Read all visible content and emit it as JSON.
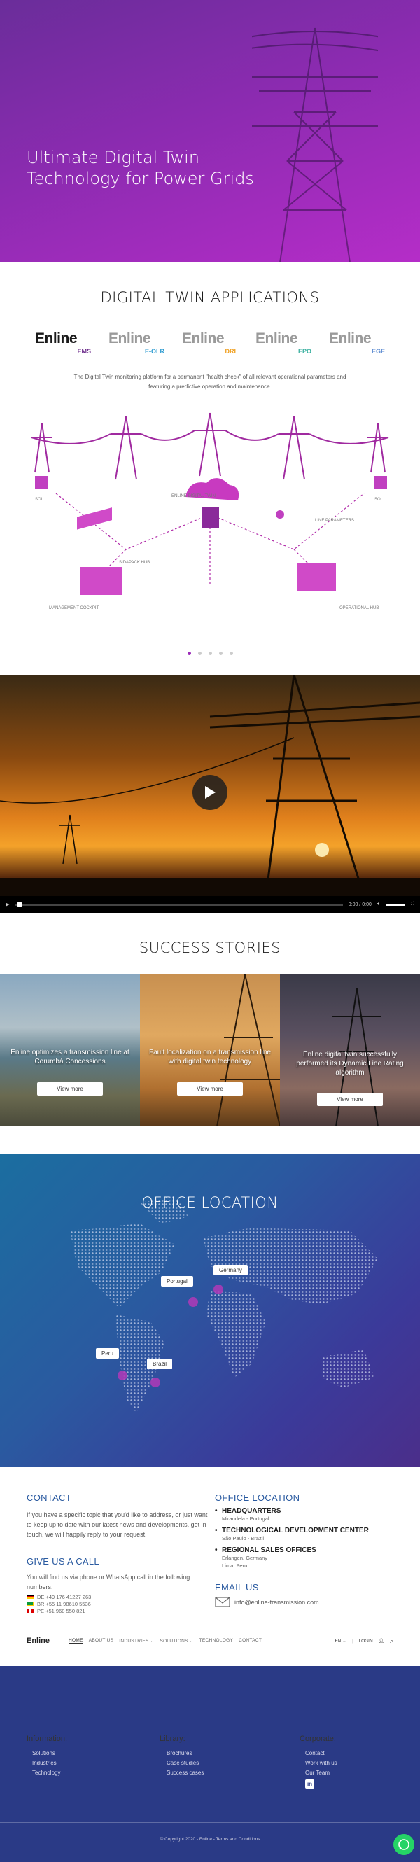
{
  "hero": {
    "title": "Ultimate Digital Twin Technology for Power Grids"
  },
  "digital_twin": {
    "title": "DIGITAL TWIN APPLICATIONS",
    "logos": [
      {
        "wordmark": "Enline",
        "code": "EMS",
        "color": "#1a1a1a",
        "code_color": "#6b2a8a"
      },
      {
        "wordmark": "Enline",
        "code": "E-OLR",
        "color": "#9a9a9a",
        "code_color": "#2a9ad0"
      },
      {
        "wordmark": "Enline",
        "code": "DRL",
        "color": "#9a9a9a",
        "code_color": "#f0a020"
      },
      {
        "wordmark": "Enline",
        "code": "EPO",
        "color": "#9a9a9a",
        "code_color": "#3ab0a0"
      },
      {
        "wordmark": "Enline",
        "code": "EGE",
        "color": "#9a9a9a",
        "code_color": "#5a8ad0"
      }
    ],
    "description": "The Digital Twin monitoring platform for a permanent \"health check\" of all relevant operational parameters and featuring a predictive operation and maintenance.",
    "illus_labels": {
      "sensors_left": "SOI",
      "sensors_right": "SOI",
      "digital_twin": "ENLINE DIGITAL TWIN",
      "sidapack": "SIDAPACK HUB",
      "line_parameters": "LINE PARAMETERS",
      "management": "MANAGEMENT COCKPIT",
      "operational": "OPERATIONAL HUB"
    },
    "slides": 5,
    "active_slide": 0
  },
  "video": {
    "time": "0:00 / 0:00"
  },
  "success": {
    "title": "SUCCESS STORIES",
    "stories": [
      {
        "caption": "Enline optimizes a transmission line at Corumbá Concessions",
        "button": "View more"
      },
      {
        "caption": "Fault localization on a transmission line with digital twin technology",
        "button": "View more"
      },
      {
        "caption": "Enline digital twin successfully performed its Dynamic Line Rating algorithm",
        "button": "View more"
      }
    ]
  },
  "office_map": {
    "title": "OFFICE LOCATION",
    "pins": [
      "Portugal",
      "Germany",
      "Peru",
      "Brazil"
    ]
  },
  "contact": {
    "title": "CONTACT",
    "text": "If you have a specific topic that you'd like to address, or just want to keep up to date with our latest news and developments, get in touch, we will happily reply to your request.",
    "call_title": "GIVE US A CALL",
    "call_text": "You will find us via phone or WhatsApp call in the following numbers:",
    "phones": [
      {
        "text": "DE +49 176 41227 263",
        "flag": "de"
      },
      {
        "text": "BR +55 11 98610 5536",
        "flag": "br"
      },
      {
        "text": "PE +51 968 550 821",
        "flag": "pe"
      }
    ]
  },
  "office_location": {
    "title": "OFFICE LOCATION",
    "items": [
      {
        "heading": "HEADQUARTERS",
        "address": "Mirandela - Portugal"
      },
      {
        "heading": "TECHNOLOGICAL DEVELOPMENT CENTER",
        "address": "São Paulo - Brazil"
      },
      {
        "heading": "REGIONAL SALES OFFICES",
        "address": "Erlangen, Germany",
        "address2": "Lima, Peru"
      }
    ],
    "email_title": "EMAIL US",
    "email": "info@enline-transmission.com"
  },
  "nav": {
    "brand": "Enline",
    "items": [
      "HOME",
      "ABOUT US",
      "INDUSTRIES ⌄",
      "SOLUTIONS ⌄",
      "TECHNOLOGY",
      "CONTACT"
    ],
    "lang": "EN ⌄",
    "login": "LOGIN"
  },
  "footer": {
    "information": {
      "title": "Information:",
      "links": [
        "Solutions",
        "Industries",
        "Technology"
      ]
    },
    "library": {
      "title": "Library:",
      "links": [
        "Brochures",
        "Case studies",
        "Success cases"
      ]
    },
    "corporate": {
      "title": "Corporate:",
      "links": [
        "Contact",
        "Work with us",
        "Our Team"
      ]
    },
    "copyright": "© Copyright 2020 - Enline - Terms and Conditions"
  }
}
